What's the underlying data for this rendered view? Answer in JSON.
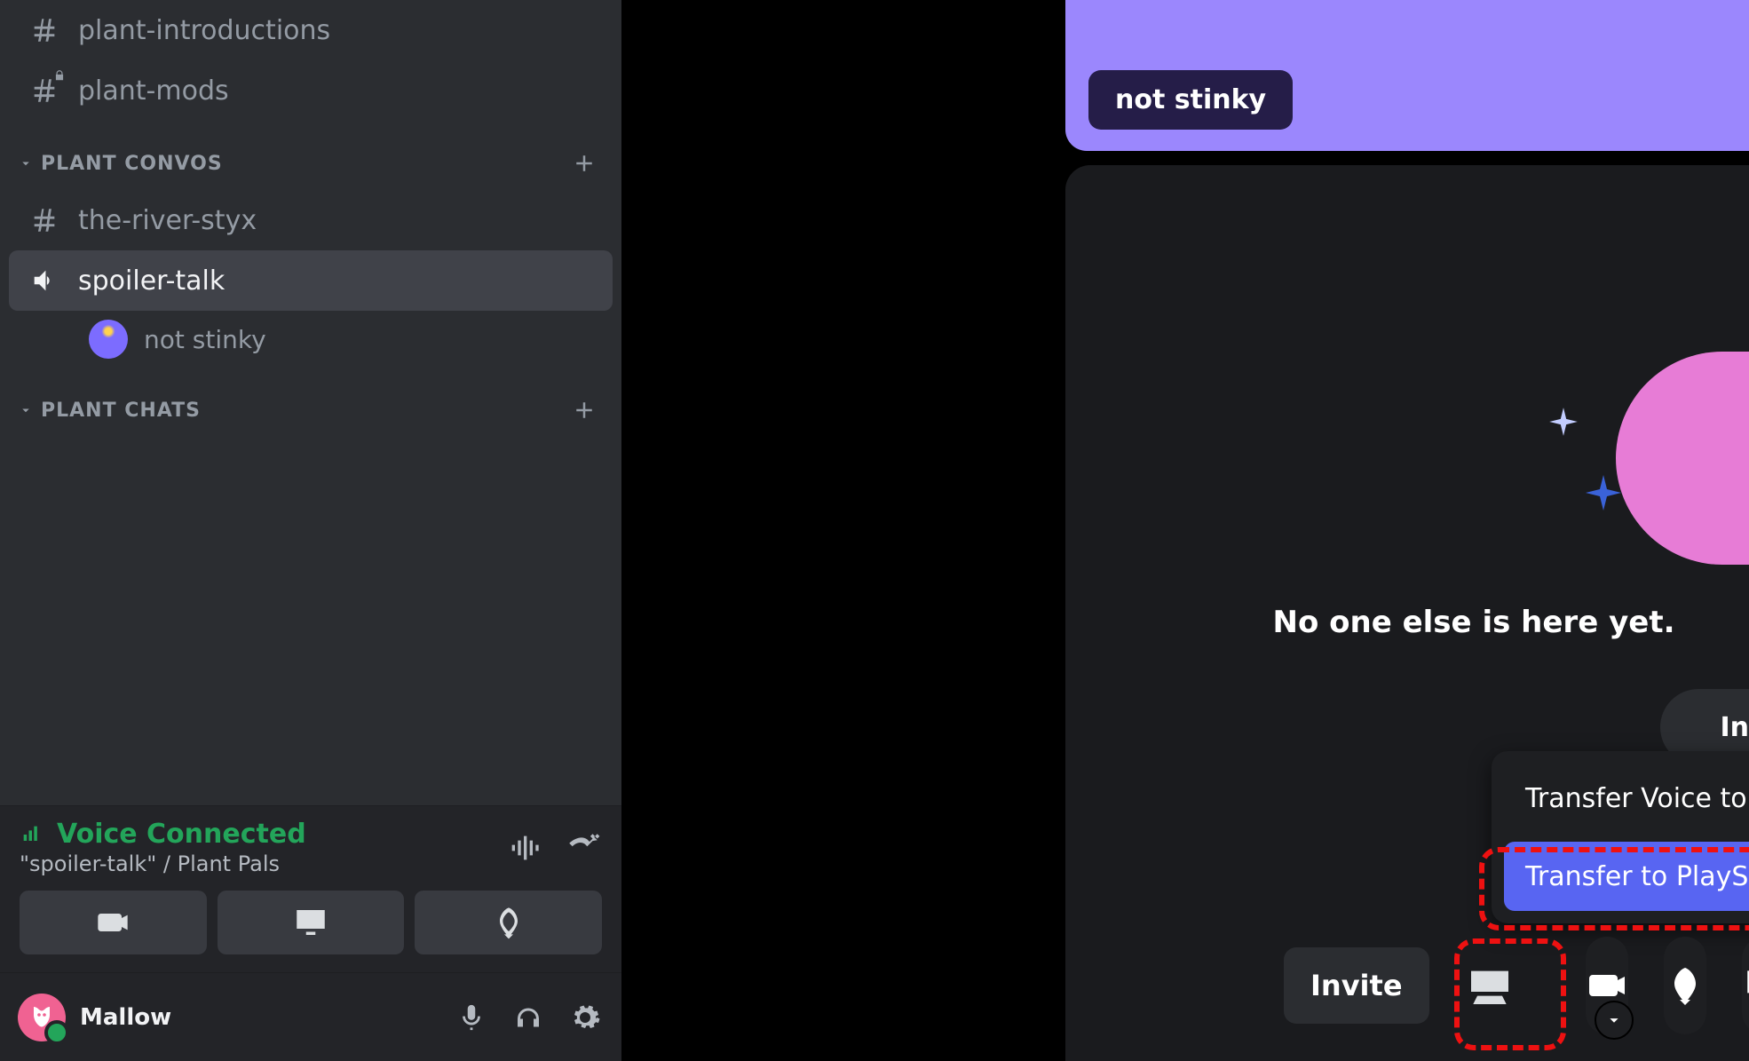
{
  "sidebar": {
    "channels_top": [
      {
        "name": "plant-introductions",
        "type": "text"
      },
      {
        "name": "plant-mods",
        "type": "text-locked"
      }
    ],
    "categories": [
      {
        "name": "PLANT CONVOS",
        "items": [
          {
            "name": "the-river-styx",
            "type": "text"
          },
          {
            "name": "spoiler-talk",
            "type": "voice",
            "selected": true,
            "users": [
              {
                "name": "not stinky"
              }
            ]
          }
        ]
      },
      {
        "name": "PLANT CHATS",
        "items": []
      }
    ]
  },
  "voice": {
    "status": "Voice Connected",
    "channel": "\"spoiler-talk\" / Plant Pals"
  },
  "user": {
    "display_name": "Mallow"
  },
  "call": {
    "self_badge": "not stinky",
    "empty_state": "No one else is here yet.",
    "pill_right_label": "In",
    "invite_label": "Invite",
    "transfer_menu": {
      "xbox": "Transfer Voice to Xbox",
      "ps": "Transfer to PlayStation"
    }
  }
}
